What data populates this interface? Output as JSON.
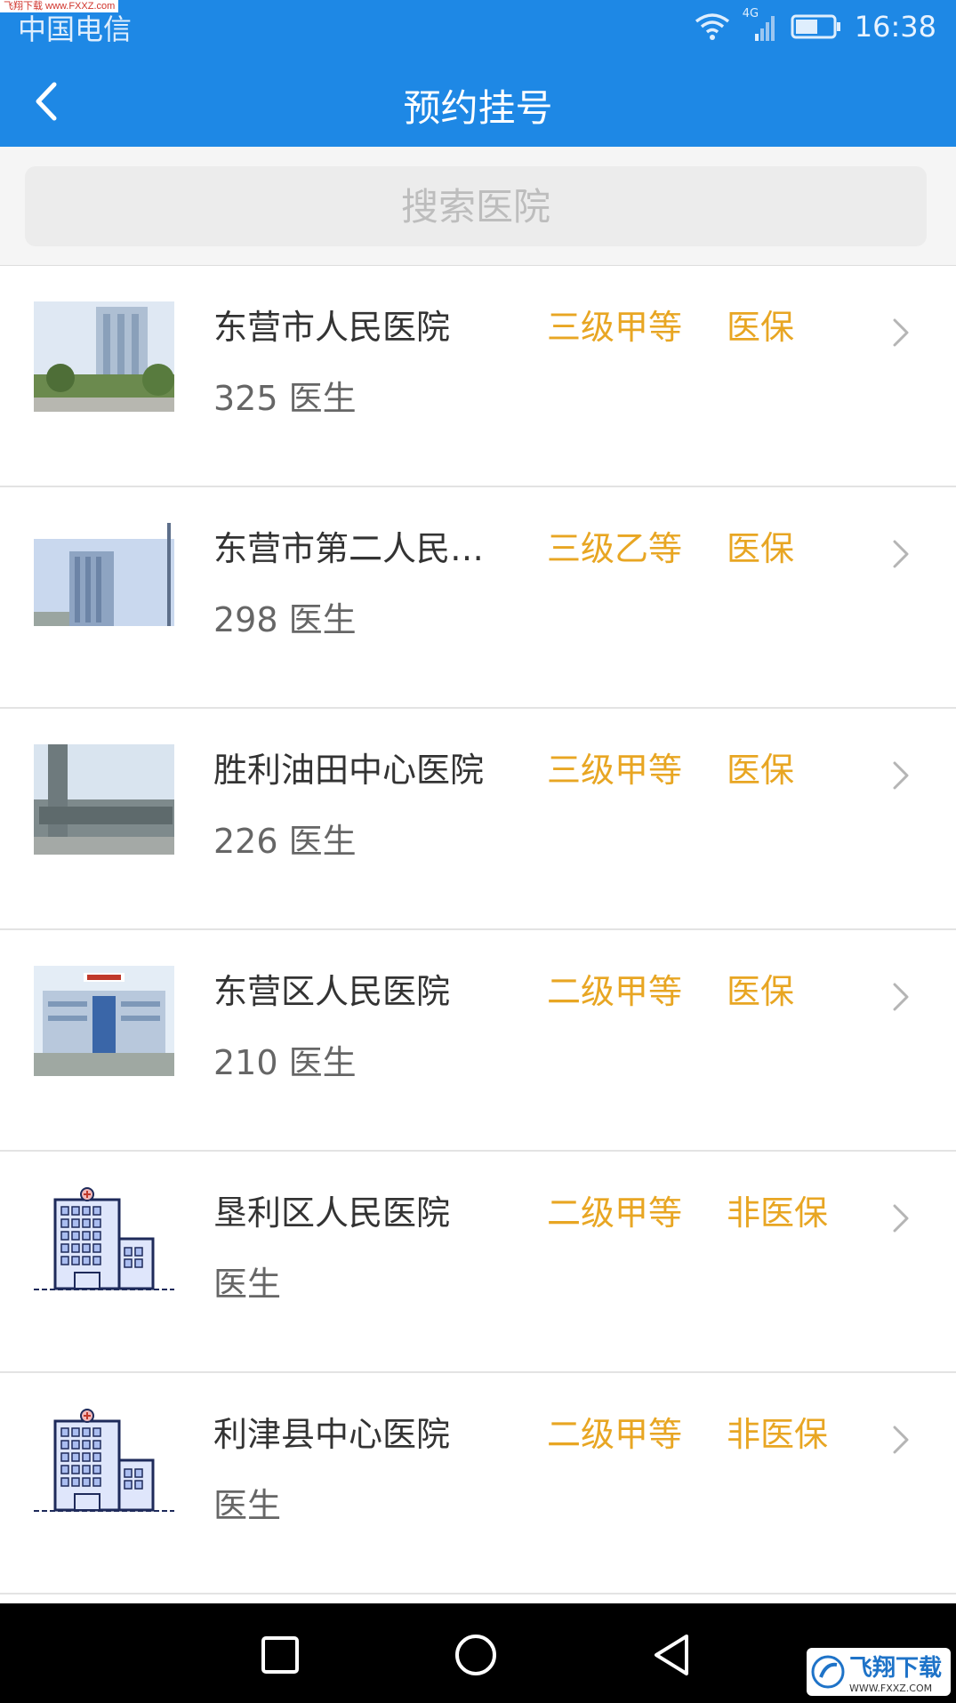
{
  "watermark": {
    "top_text": "飞翔下载 www.FXXZ.com",
    "logo_text": "飞翔下载",
    "logo_url": "WWW.FXXZ.COM"
  },
  "status_bar": {
    "carrier": "中国电信",
    "network": "4G",
    "time": "16:38"
  },
  "app_bar": {
    "title": "预约挂号",
    "back_icon": "chevron-left-icon"
  },
  "search": {
    "placeholder": "搜索医院",
    "value": ""
  },
  "colors": {
    "primary": "#1e88e5",
    "tag": "#e8a623",
    "text": "#333333",
    "subtext": "#666666"
  },
  "hospitals": [
    {
      "name": "东营市人民医院",
      "doctors": "325 医生",
      "level": "三级甲等",
      "insurance": "医保",
      "image": "hospital-photo"
    },
    {
      "name": "东营市第二人民…",
      "doctors": "298 医生",
      "level": "三级乙等",
      "insurance": "医保",
      "image": "hospital-photo"
    },
    {
      "name": "胜利油田中心医院",
      "doctors": "226 医生",
      "level": "三级甲等",
      "insurance": "医保",
      "image": "hospital-photo"
    },
    {
      "name": "东营区人民医院",
      "doctors": "210 医生",
      "level": "二级甲等",
      "insurance": "医保",
      "image": "hospital-photo"
    },
    {
      "name": "垦利区人民医院",
      "doctors": "医生",
      "level": "二级甲等",
      "insurance": "非医保",
      "image": "hospital-building-icon"
    },
    {
      "name": "利津县中心医院",
      "doctors": "医生",
      "level": "二级甲等",
      "insurance": "非医保",
      "image": "hospital-building-icon"
    }
  ],
  "nav": {
    "recent": "square-icon",
    "home": "circle-icon",
    "back": "triangle-back-icon"
  }
}
